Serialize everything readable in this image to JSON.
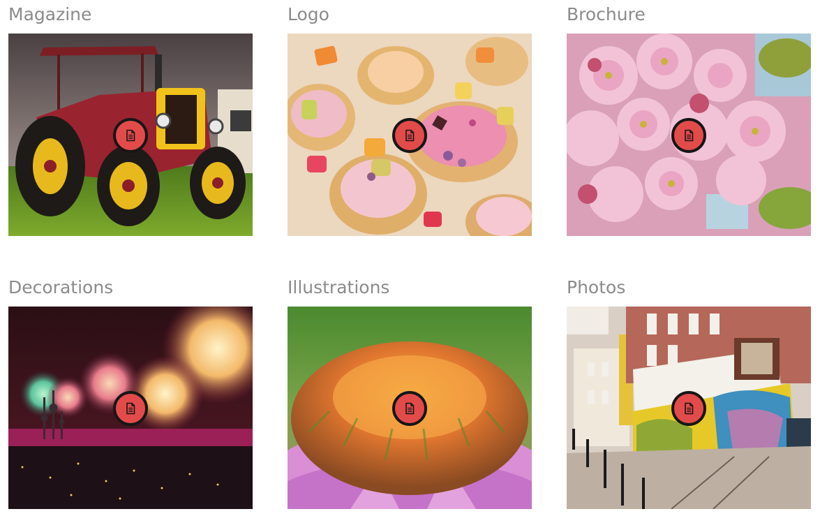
{
  "gallery": {
    "items": [
      {
        "title": "Magazine",
        "image": "red-tractor-photo",
        "icon": "document-icon"
      },
      {
        "title": "Logo",
        "image": "decorated-cookies-photo",
        "icon": "document-icon"
      },
      {
        "title": "Brochure",
        "image": "pink-blossoms-photo",
        "icon": "document-icon"
      },
      {
        "title": "Decorations",
        "image": "fireworks-photo",
        "icon": "document-icon"
      },
      {
        "title": "Illustrations",
        "image": "coneflower-photo",
        "icon": "document-icon"
      },
      {
        "title": "Photos",
        "image": "graffiti-tram-photo",
        "icon": "document-icon"
      }
    ]
  },
  "colors": {
    "badge": "#e34b4b",
    "badge_border": "#161616",
    "title_text": "#8b8b8b"
  }
}
